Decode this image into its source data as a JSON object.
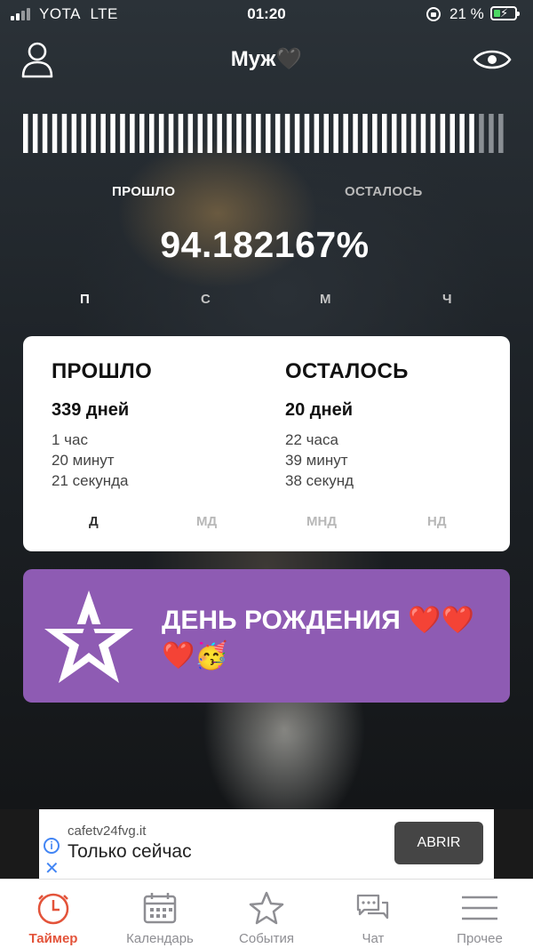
{
  "status_bar": {
    "carrier": "YOTA",
    "network": "LTE",
    "time": "01:20",
    "battery": "21 %"
  },
  "header": {
    "title": "Муж🖤"
  },
  "progress": {
    "passed_label": "ПРОШЛО",
    "left_label": "ОСТАЛОСЬ",
    "percent_text": "94.182167%",
    "fraction": 0.9418
  },
  "units": [
    "П",
    "С",
    "М",
    "Ч"
  ],
  "card": {
    "passed": {
      "heading": "ПРОШЛО",
      "days": "339 дней",
      "hours": "1 час",
      "minutes": "20 минут",
      "seconds": "21 секунда"
    },
    "left": {
      "heading": "ОСТАЛОСЬ",
      "days": "20 дней",
      "hours": "22 часа",
      "minutes": "39 минут",
      "seconds": "38 секунд"
    },
    "tabs": [
      "Д",
      "МД",
      "МНД",
      "НД"
    ]
  },
  "event": {
    "text": "ДЕНЬ РОЖДЕНИЯ ❤️❤️❤️🥳",
    "color": "#8e5bb3"
  },
  "ad": {
    "domain": "cafetv24fvg.it",
    "title": "Только сейчас",
    "button": "ABRIR"
  },
  "tabbar": {
    "accent": "#e3533a",
    "items": [
      {
        "label": "Таймер",
        "icon": "clock-icon"
      },
      {
        "label": "Календарь",
        "icon": "calendar-icon"
      },
      {
        "label": "События",
        "icon": "star-icon"
      },
      {
        "label": "Чат",
        "icon": "chat-icon"
      },
      {
        "label": "Прочее",
        "icon": "menu-icon"
      }
    ]
  }
}
